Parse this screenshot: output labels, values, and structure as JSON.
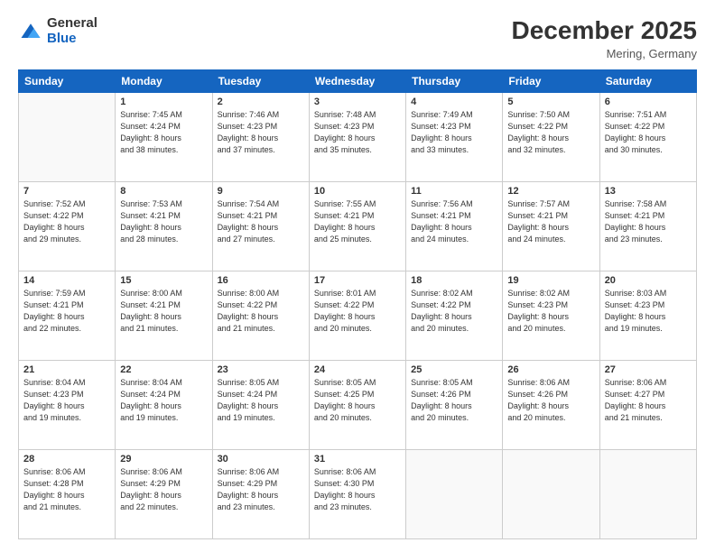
{
  "logo": {
    "general": "General",
    "blue": "Blue"
  },
  "title": "December 2025",
  "location": "Mering, Germany",
  "days_of_week": [
    "Sunday",
    "Monday",
    "Tuesday",
    "Wednesday",
    "Thursday",
    "Friday",
    "Saturday"
  ],
  "weeks": [
    [
      {
        "day": "",
        "sunrise": "",
        "sunset": "",
        "daylight": ""
      },
      {
        "day": "1",
        "sunrise": "Sunrise: 7:45 AM",
        "sunset": "Sunset: 4:24 PM",
        "daylight": "Daylight: 8 hours and 38 minutes."
      },
      {
        "day": "2",
        "sunrise": "Sunrise: 7:46 AM",
        "sunset": "Sunset: 4:23 PM",
        "daylight": "Daylight: 8 hours and 37 minutes."
      },
      {
        "day": "3",
        "sunrise": "Sunrise: 7:48 AM",
        "sunset": "Sunset: 4:23 PM",
        "daylight": "Daylight: 8 hours and 35 minutes."
      },
      {
        "day": "4",
        "sunrise": "Sunrise: 7:49 AM",
        "sunset": "Sunset: 4:23 PM",
        "daylight": "Daylight: 8 hours and 33 minutes."
      },
      {
        "day": "5",
        "sunrise": "Sunrise: 7:50 AM",
        "sunset": "Sunset: 4:22 PM",
        "daylight": "Daylight: 8 hours and 32 minutes."
      },
      {
        "day": "6",
        "sunrise": "Sunrise: 7:51 AM",
        "sunset": "Sunset: 4:22 PM",
        "daylight": "Daylight: 8 hours and 30 minutes."
      }
    ],
    [
      {
        "day": "7",
        "sunrise": "Sunrise: 7:52 AM",
        "sunset": "Sunset: 4:22 PM",
        "daylight": "Daylight: 8 hours and 29 minutes."
      },
      {
        "day": "8",
        "sunrise": "Sunrise: 7:53 AM",
        "sunset": "Sunset: 4:21 PM",
        "daylight": "Daylight: 8 hours and 28 minutes."
      },
      {
        "day": "9",
        "sunrise": "Sunrise: 7:54 AM",
        "sunset": "Sunset: 4:21 PM",
        "daylight": "Daylight: 8 hours and 27 minutes."
      },
      {
        "day": "10",
        "sunrise": "Sunrise: 7:55 AM",
        "sunset": "Sunset: 4:21 PM",
        "daylight": "Daylight: 8 hours and 25 minutes."
      },
      {
        "day": "11",
        "sunrise": "Sunrise: 7:56 AM",
        "sunset": "Sunset: 4:21 PM",
        "daylight": "Daylight: 8 hours and 24 minutes."
      },
      {
        "day": "12",
        "sunrise": "Sunrise: 7:57 AM",
        "sunset": "Sunset: 4:21 PM",
        "daylight": "Daylight: 8 hours and 24 minutes."
      },
      {
        "day": "13",
        "sunrise": "Sunrise: 7:58 AM",
        "sunset": "Sunset: 4:21 PM",
        "daylight": "Daylight: 8 hours and 23 minutes."
      }
    ],
    [
      {
        "day": "14",
        "sunrise": "Sunrise: 7:59 AM",
        "sunset": "Sunset: 4:21 PM",
        "daylight": "Daylight: 8 hours and 22 minutes."
      },
      {
        "day": "15",
        "sunrise": "Sunrise: 8:00 AM",
        "sunset": "Sunset: 4:21 PM",
        "daylight": "Daylight: 8 hours and 21 minutes."
      },
      {
        "day": "16",
        "sunrise": "Sunrise: 8:00 AM",
        "sunset": "Sunset: 4:22 PM",
        "daylight": "Daylight: 8 hours and 21 minutes."
      },
      {
        "day": "17",
        "sunrise": "Sunrise: 8:01 AM",
        "sunset": "Sunset: 4:22 PM",
        "daylight": "Daylight: 8 hours and 20 minutes."
      },
      {
        "day": "18",
        "sunrise": "Sunrise: 8:02 AM",
        "sunset": "Sunset: 4:22 PM",
        "daylight": "Daylight: 8 hours and 20 minutes."
      },
      {
        "day": "19",
        "sunrise": "Sunrise: 8:02 AM",
        "sunset": "Sunset: 4:23 PM",
        "daylight": "Daylight: 8 hours and 20 minutes."
      },
      {
        "day": "20",
        "sunrise": "Sunrise: 8:03 AM",
        "sunset": "Sunset: 4:23 PM",
        "daylight": "Daylight: 8 hours and 19 minutes."
      }
    ],
    [
      {
        "day": "21",
        "sunrise": "Sunrise: 8:04 AM",
        "sunset": "Sunset: 4:23 PM",
        "daylight": "Daylight: 8 hours and 19 minutes."
      },
      {
        "day": "22",
        "sunrise": "Sunrise: 8:04 AM",
        "sunset": "Sunset: 4:24 PM",
        "daylight": "Daylight: 8 hours and 19 minutes."
      },
      {
        "day": "23",
        "sunrise": "Sunrise: 8:05 AM",
        "sunset": "Sunset: 4:24 PM",
        "daylight": "Daylight: 8 hours and 19 minutes."
      },
      {
        "day": "24",
        "sunrise": "Sunrise: 8:05 AM",
        "sunset": "Sunset: 4:25 PM",
        "daylight": "Daylight: 8 hours and 20 minutes."
      },
      {
        "day": "25",
        "sunrise": "Sunrise: 8:05 AM",
        "sunset": "Sunset: 4:26 PM",
        "daylight": "Daylight: 8 hours and 20 minutes."
      },
      {
        "day": "26",
        "sunrise": "Sunrise: 8:06 AM",
        "sunset": "Sunset: 4:26 PM",
        "daylight": "Daylight: 8 hours and 20 minutes."
      },
      {
        "day": "27",
        "sunrise": "Sunrise: 8:06 AM",
        "sunset": "Sunset: 4:27 PM",
        "daylight": "Daylight: 8 hours and 21 minutes."
      }
    ],
    [
      {
        "day": "28",
        "sunrise": "Sunrise: 8:06 AM",
        "sunset": "Sunset: 4:28 PM",
        "daylight": "Daylight: 8 hours and 21 minutes."
      },
      {
        "day": "29",
        "sunrise": "Sunrise: 8:06 AM",
        "sunset": "Sunset: 4:29 PM",
        "daylight": "Daylight: 8 hours and 22 minutes."
      },
      {
        "day": "30",
        "sunrise": "Sunrise: 8:06 AM",
        "sunset": "Sunset: 4:29 PM",
        "daylight": "Daylight: 8 hours and 23 minutes."
      },
      {
        "day": "31",
        "sunrise": "Sunrise: 8:06 AM",
        "sunset": "Sunset: 4:30 PM",
        "daylight": "Daylight: 8 hours and 23 minutes."
      },
      {
        "day": "",
        "sunrise": "",
        "sunset": "",
        "daylight": ""
      },
      {
        "day": "",
        "sunrise": "",
        "sunset": "",
        "daylight": ""
      },
      {
        "day": "",
        "sunrise": "",
        "sunset": "",
        "daylight": ""
      }
    ]
  ]
}
